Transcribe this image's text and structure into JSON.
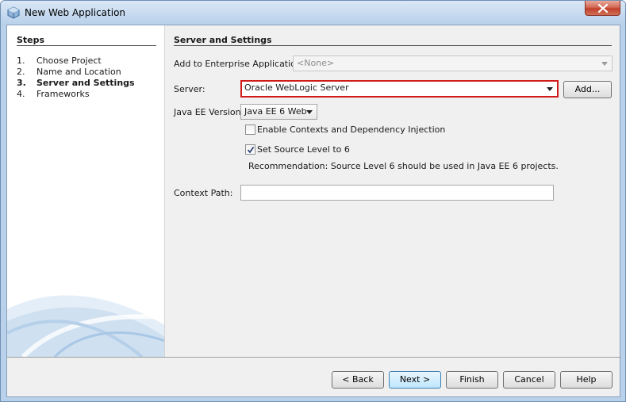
{
  "window": {
    "title": "New Web Application"
  },
  "steps": {
    "title": "Steps",
    "items": [
      {
        "num": "1.",
        "label": "Choose Project"
      },
      {
        "num": "2.",
        "label": "Name and Location"
      },
      {
        "num": "3.",
        "label": "Server and Settings"
      },
      {
        "num": "4.",
        "label": "Frameworks"
      }
    ]
  },
  "main": {
    "section_title": "Server and Settings",
    "enterprise_label": "Add to Enterprise Application:",
    "enterprise_value": "<None>",
    "server_label": "Server:",
    "server_value": "Oracle WebLogic Server",
    "add_button": "Add...",
    "javaee_label": "Java EE Version:",
    "javaee_value": "Java EE 6 Web",
    "cdi_label": "Enable Contexts and Dependency Injection",
    "source_level_label": "Set Source Level to 6",
    "recommendation": "Recommendation: Source Level 6 should be used in Java EE 6 projects.",
    "context_path_label": "Context Path:",
    "context_path_value": ""
  },
  "footer": {
    "back": "< Back",
    "next": "Next >",
    "finish": "Finish",
    "cancel": "Cancel",
    "help": "Help"
  },
  "colors": {
    "highlight": "#d11a1a",
    "frame": "#b9d1ea"
  }
}
